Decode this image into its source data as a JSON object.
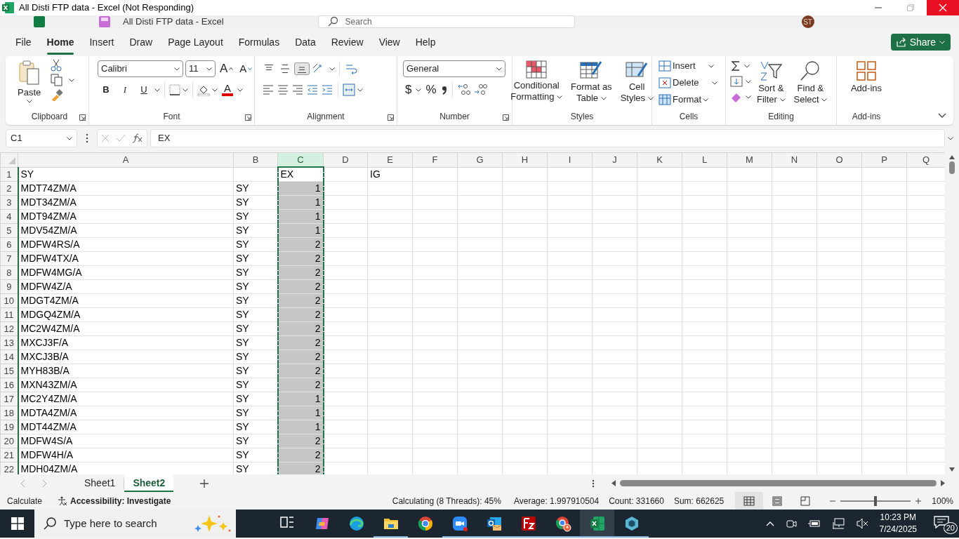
{
  "window": {
    "title": "All Disti FTP data - Excel (Not Responding)",
    "ghost_title": "All Disti FTP data  -  Excel",
    "search_placeholder": "Search",
    "avatar": "ST"
  },
  "menu_tabs": [
    {
      "label": "File",
      "selected": false
    },
    {
      "label": "Home",
      "selected": true
    },
    {
      "label": "Insert",
      "selected": false
    },
    {
      "label": "Draw",
      "selected": false
    },
    {
      "label": "Page Layout",
      "selected": false
    },
    {
      "label": "Formulas",
      "selected": false
    },
    {
      "label": "Data",
      "selected": false
    },
    {
      "label": "Review",
      "selected": false
    },
    {
      "label": "View",
      "selected": false
    },
    {
      "label": "Help",
      "selected": false
    }
  ],
  "share": "Share",
  "ribbon": {
    "clipboard": {
      "paste": "Paste",
      "label": "Clipboard"
    },
    "font": {
      "name": "Calibri",
      "size": "11",
      "grow": "A",
      "shrink": "A",
      "bold": "B",
      "italic": "I",
      "underline": "U",
      "font_color": "A",
      "label": "Font"
    },
    "alignment": {
      "vertical": [
        {
          "selected": false
        },
        {
          "selected": false
        },
        {
          "selected": true
        }
      ],
      "label": "Alignment"
    },
    "number": {
      "format": "General",
      "currency": "$",
      "percent": "%",
      "label": "Number"
    },
    "styles": {
      "conditional": [
        "Conditional",
        "Formatting"
      ],
      "table": [
        "Format as",
        "Table"
      ],
      "cell_styles": [
        "Cell",
        "Styles"
      ],
      "label": "Styles"
    },
    "cells": {
      "insert": "Insert",
      "delete": "Delete",
      "format": "Format",
      "label": "Cells"
    },
    "editing": {
      "sort": [
        "Sort &",
        "Filter"
      ],
      "find": [
        "Find &",
        "Select"
      ],
      "label": "Editing"
    },
    "addins": {
      "button": "Add-ins",
      "label": "Add-ins"
    }
  },
  "formula_bar": {
    "name_box": "C1",
    "formula": "EX"
  },
  "columns": [
    {
      "letter": "A",
      "selected": false
    },
    {
      "letter": "B",
      "selected": false
    },
    {
      "letter": "C",
      "selected": true
    },
    {
      "letter": "D",
      "selected": false
    },
    {
      "letter": "E",
      "selected": false
    },
    {
      "letter": "F",
      "selected": false
    },
    {
      "letter": "G",
      "selected": false
    },
    {
      "letter": "H",
      "selected": false
    },
    {
      "letter": "I",
      "selected": false
    },
    {
      "letter": "J",
      "selected": false
    },
    {
      "letter": "K",
      "selected": false
    },
    {
      "letter": "L",
      "selected": false
    },
    {
      "letter": "M",
      "selected": false
    },
    {
      "letter": "N",
      "selected": false
    },
    {
      "letter": "O",
      "selected": false
    },
    {
      "letter": "P",
      "selected": false
    },
    {
      "letter": "Q",
      "selected": false
    }
  ],
  "rows": [
    {
      "number": "1",
      "selected": true,
      "active": true,
      "cells": {
        "A": "SY",
        "C": "EX",
        "E": "IG"
      }
    },
    {
      "number": "2",
      "selected": true,
      "active": false,
      "cells": {
        "A": "MDT74ZM/A",
        "B": "SY",
        "C": "1"
      }
    },
    {
      "number": "3",
      "selected": true,
      "active": false,
      "cells": {
        "A": "MDT34ZM/A",
        "B": "SY",
        "C": "1"
      }
    },
    {
      "number": "4",
      "selected": true,
      "active": false,
      "cells": {
        "A": "MDT94ZM/A",
        "B": "SY",
        "C": "1"
      }
    },
    {
      "number": "5",
      "selected": true,
      "active": false,
      "cells": {
        "A": "MDV54ZM/A",
        "B": "SY",
        "C": "1"
      }
    },
    {
      "number": "6",
      "selected": true,
      "active": false,
      "cells": {
        "A": "MDFW4RS/A",
        "B": "SY",
        "C": "2"
      }
    },
    {
      "number": "7",
      "selected": true,
      "active": false,
      "cells": {
        "A": "MDFW4TX/A",
        "B": "SY",
        "C": "2"
      }
    },
    {
      "number": "8",
      "selected": true,
      "active": false,
      "cells": {
        "A": "MDFW4MG/A",
        "B": "SY",
        "C": "2"
      }
    },
    {
      "number": "9",
      "selected": true,
      "active": false,
      "cells": {
        "A": "MDFW4Z/A",
        "B": "SY",
        "C": "2"
      }
    },
    {
      "number": "10",
      "selected": true,
      "active": false,
      "cells": {
        "A": "MDGT4ZM/A",
        "B": "SY",
        "C": "2"
      }
    },
    {
      "number": "11",
      "selected": true,
      "active": false,
      "cells": {
        "A": "MDGQ4ZM/A",
        "B": "SY",
        "C": "2"
      }
    },
    {
      "number": "12",
      "selected": true,
      "active": false,
      "cells": {
        "A": "MC2W4ZM/A",
        "B": "SY",
        "C": "2"
      }
    },
    {
      "number": "13",
      "selected": true,
      "active": false,
      "cells": {
        "A": "MXCJ3F/A",
        "B": "SY",
        "C": "2"
      }
    },
    {
      "number": "14",
      "selected": true,
      "active": false,
      "cells": {
        "A": "MXCJ3B/A",
        "B": "SY",
        "C": "2"
      }
    },
    {
      "number": "15",
      "selected": true,
      "active": false,
      "cells": {
        "A": "MYH83B/A",
        "B": "SY",
        "C": "2"
      }
    },
    {
      "number": "16",
      "selected": true,
      "active": false,
      "cells": {
        "A": "MXN43ZM/A",
        "B": "SY",
        "C": "2"
      }
    },
    {
      "number": "17",
      "selected": true,
      "active": false,
      "cells": {
        "A": "MC2Y4ZM/A",
        "B": "SY",
        "C": "1"
      }
    },
    {
      "number": "18",
      "selected": true,
      "active": false,
      "cells": {
        "A": "MDTA4ZM/A",
        "B": "SY",
        "C": "1"
      }
    },
    {
      "number": "19",
      "selected": true,
      "active": false,
      "cells": {
        "A": "MDT44ZM/A",
        "B": "SY",
        "C": "1"
      }
    },
    {
      "number": "20",
      "selected": true,
      "active": false,
      "cells": {
        "A": "MDFW4S/A",
        "B": "SY",
        "C": "2"
      }
    },
    {
      "number": "21",
      "selected": true,
      "active": false,
      "cells": {
        "A": "MDFW4H/A",
        "B": "SY",
        "C": "2"
      }
    },
    {
      "number": "22",
      "selected": true,
      "active": false,
      "cells": {
        "A": "MDH04ZM/A",
        "B": "SY",
        "C": "2"
      }
    }
  ],
  "sheet_tabs": [
    {
      "label": "Sheet1",
      "selected": false
    },
    {
      "label": "Sheet2",
      "selected": true
    }
  ],
  "status_bar": {
    "mode": "Calculate",
    "accessibility": "Accessibility: Investigate",
    "progress": "Calculating (8 Threads): 45%",
    "average": "Average: 1.997910504",
    "count": "Count: 331660",
    "sum": "Sum: 662625",
    "views": [
      {
        "selected": true
      },
      {
        "selected": false
      },
      {
        "selected": false
      }
    ],
    "zoom_slider": {
      "level": 0.5
    },
    "zoom": "100%"
  },
  "taskbar": {
    "search_placeholder": "Type here to search",
    "apps": [
      {
        "kind": "taskview",
        "running": false,
        "selected": false
      },
      {
        "kind": "copilot",
        "running": false,
        "selected": false
      },
      {
        "kind": "edge",
        "running": false,
        "selected": false
      },
      {
        "kind": "explorer",
        "running": true,
        "selected": false
      },
      {
        "kind": "chrome",
        "running": false,
        "selected": false
      },
      {
        "kind": "zoom",
        "running": true,
        "selected": false
      },
      {
        "kind": "outlook",
        "running": true,
        "selected": false
      },
      {
        "kind": "filezilla",
        "running": true,
        "selected": false
      },
      {
        "kind": "chromeprofile",
        "running": true,
        "selected": false
      },
      {
        "kind": "excel",
        "running": true,
        "selected": true
      },
      {
        "kind": "hexapp",
        "running": true,
        "selected": false
      }
    ],
    "time": "10:23 PM",
    "date": "7/24/2025",
    "notifications": "20"
  }
}
